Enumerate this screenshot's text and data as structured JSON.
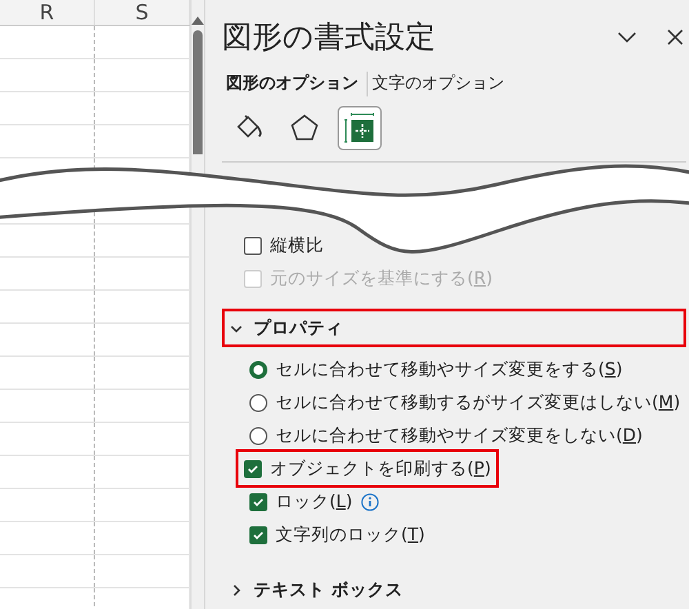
{
  "sheet": {
    "columns": [
      "R",
      "S"
    ]
  },
  "panel": {
    "title": "図形の書式設定",
    "tabs": [
      {
        "label": "図形のオプション",
        "selected": true
      },
      {
        "label": "文字のオプション",
        "selected": false
      }
    ],
    "icon_tabs": [
      {
        "kind": "fill",
        "selected": false
      },
      {
        "kind": "shape",
        "selected": false
      },
      {
        "kind": "size",
        "selected": true
      }
    ],
    "size_options": [
      {
        "kind": "checkbox",
        "label": "縦横比",
        "checked": false,
        "disabled": false,
        "mnemonic": false
      },
      {
        "kind": "checkbox",
        "label": "元のサイズを基準にする(R)",
        "checked": false,
        "disabled": true,
        "mnemonic": true
      }
    ],
    "properties": {
      "label": "プロパティ",
      "expanded": true,
      "highlighted": true,
      "items": [
        {
          "kind": "radio",
          "label": "セルに合わせて移動やサイズ変更をする(S)",
          "selected": true,
          "highlighted": false,
          "info": false
        },
        {
          "kind": "radio",
          "label": "セルに合わせて移動するがサイズ変更はしない(M)",
          "selected": false,
          "highlighted": false,
          "info": false
        },
        {
          "kind": "radio",
          "label": "セルに合わせて移動やサイズ変更をしない(D)",
          "selected": false,
          "highlighted": false,
          "info": false
        },
        {
          "kind": "checkbox",
          "label": "オブジェクトを印刷する(P)",
          "checked": true,
          "highlighted": true,
          "info": false
        },
        {
          "kind": "checkbox",
          "label": "ロック(L)",
          "checked": true,
          "highlighted": false,
          "info": true
        },
        {
          "kind": "checkbox",
          "label": "文字列のロック(T)",
          "checked": true,
          "highlighted": false,
          "info": false
        }
      ]
    },
    "text_box": {
      "label": "テキスト ボックス",
      "expanded": false
    }
  }
}
